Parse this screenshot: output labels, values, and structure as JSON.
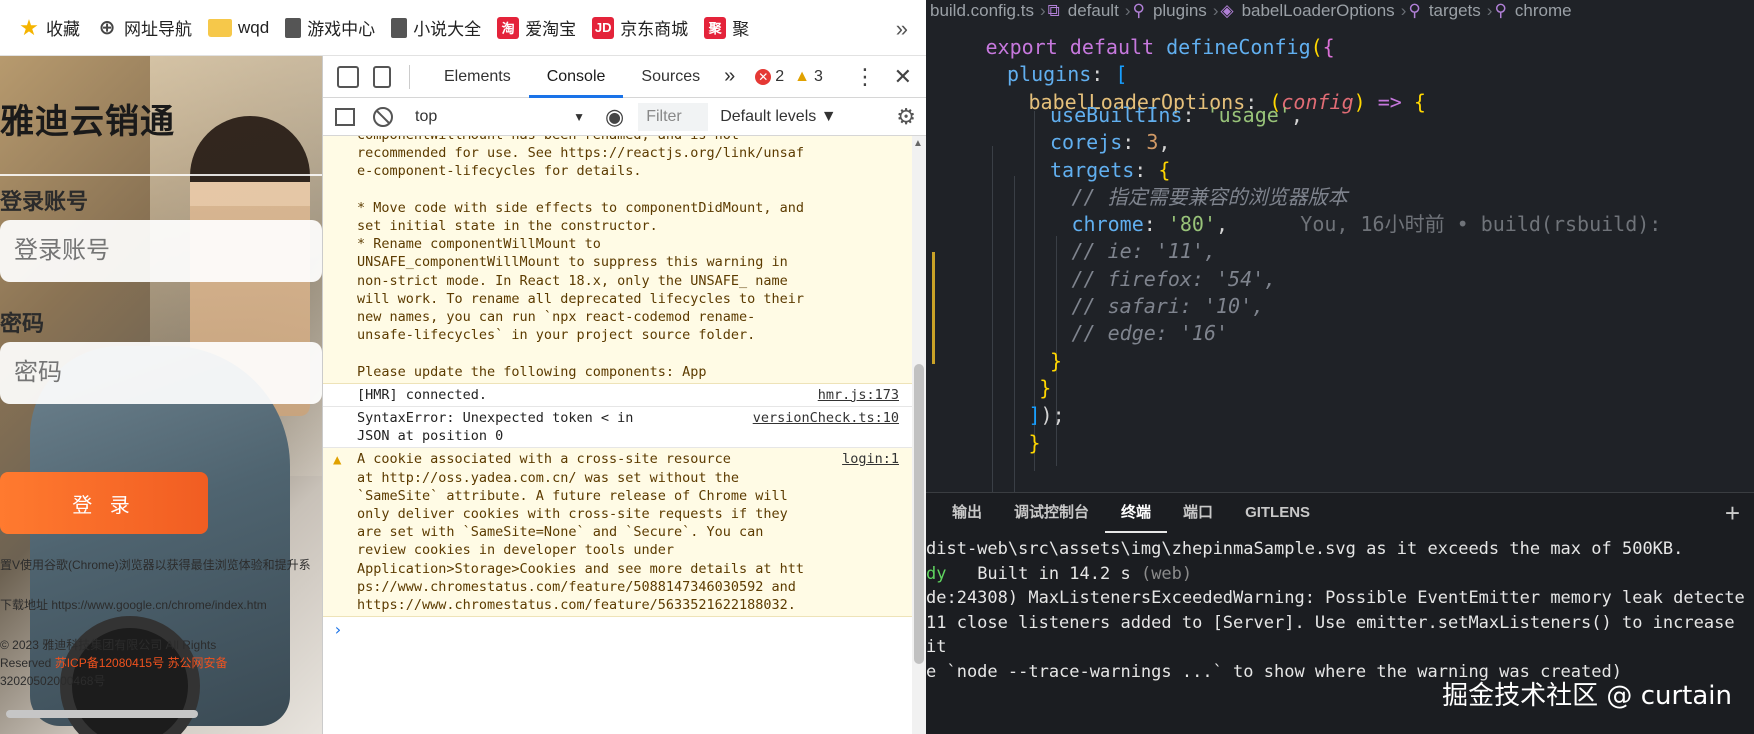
{
  "bookmarks": {
    "items": [
      {
        "label": "收藏",
        "icon": "star-icon"
      },
      {
        "label": "网址导航",
        "icon": "globe-icon"
      },
      {
        "label": "wqd",
        "icon": "folder-icon"
      },
      {
        "label": "游戏中心",
        "icon": "doc-icon"
      },
      {
        "label": "小说大全",
        "icon": "doc-icon"
      },
      {
        "label": "爱淘宝",
        "icon": "taobao-icon",
        "badge": "淘"
      },
      {
        "label": "京东商城",
        "icon": "jd-icon",
        "badge": "JD"
      },
      {
        "label": "聚",
        "icon": "ju-icon",
        "badge": "聚"
      }
    ],
    "more": "»"
  },
  "login": {
    "title": "雅迪云销通",
    "account_label": "登录账号",
    "account_placeholder": "登录账号",
    "password_label": "密码",
    "password_placeholder": "密码",
    "login_button": "登 录",
    "footer_line1": "置V使用谷歌(Chrome)浏览器以获得最佳浏览体验和提升系",
    "footer_line2": "下载地址 https://www.google.cn/chrome/index.htm",
    "footer_line3": "© 2023 雅迪科技集团有限公司 All Rights",
    "footer_line4_prefix": "Reserved",
    "footer_icp": "苏ICP备12080415号",
    "footer_police": "苏公网安备",
    "footer_line5": "32020502000468号"
  },
  "devtools": {
    "tabs": [
      "Elements",
      "Console",
      "Sources"
    ],
    "active_tab": "Console",
    "more_tabs": "»",
    "error_count": "2",
    "warning_count": "3",
    "context": "top",
    "filter_placeholder": "Filter",
    "levels": "Default levels ▼",
    "messages": [
      {
        "type": "warn",
        "text": "componentWillMount has been renamed, and is not\nrecommended for use. See https://reactjs.org/link/unsaf\ne-component-lifecycles for details.\n\n* Move code with side effects to componentDidMount, and\nset initial state in the constructor.\n* Rename componentWillMount to\nUNSAFE_componentWillMount to suppress this warning in\nnon-strict mode. In React 18.x, only the UNSAFE_ name\nwill work. To rename all deprecated lifecycles to their\nnew names, you can run `npx react-codemod rename-\nunsafe-lifecycles` in your project source folder.\n\nPlease update the following components: App",
        "source": ""
      },
      {
        "type": "info",
        "text": "[HMR] connected.",
        "source": "hmr.js:173"
      },
      {
        "type": "info",
        "text": "SyntaxError: Unexpected token < in\nJSON at position 0",
        "source": "versionCheck.ts:10"
      },
      {
        "type": "warn-icon",
        "text": "A cookie associated with a cross-site resource\nat http://oss.yadea.com.cn/ was set without the\n`SameSite` attribute. A future release of Chrome will\nonly deliver cookies with cross-site requests if they\nare set with `SameSite=None` and `Secure`. You can\nreview cookies in developer tools under\nApplication>Storage>Cookies and see more details at htt\nps://www.chromestatus.com/feature/5088147346030592 and\nhttps://www.chromestatus.com/feature/5633521622188032.",
        "source": "login:1"
      }
    ],
    "prompt": "›"
  },
  "vscode": {
    "breadcrumbs": [
      "build.config.ts",
      "default",
      "plugins",
      "babelLoaderOptions",
      "targets",
      "chrome"
    ],
    "code_lines": [
      {
        "indent": 1,
        "tokens": [
          [
            "kw",
            "export "
          ],
          [
            "kw",
            "default "
          ],
          [
            "fn",
            "defineConfig"
          ],
          [
            "br1",
            "("
          ],
          [
            "br2",
            "{"
          ]
        ]
      },
      {
        "indent": 2,
        "tokens": [
          [
            "key",
            "plugins"
          ],
          [
            "plain",
            ": "
          ],
          [
            "br3",
            "["
          ]
        ]
      },
      {
        "indent": 3,
        "tokens": [
          [
            "prop",
            "babelLoaderOptions"
          ],
          [
            "plain",
            ": "
          ],
          [
            "br1",
            "("
          ],
          [
            "param",
            "config"
          ],
          [
            "br1",
            ")"
          ],
          [
            "plain",
            " "
          ],
          [
            "kw",
            "=>"
          ],
          [
            "plain",
            " "
          ],
          [
            "br1",
            "{"
          ]
        ]
      },
      {
        "indent": 4,
        "tokens": [
          [
            "key",
            "useBuiltIns"
          ],
          [
            "plain",
            ": "
          ],
          [
            "str",
            "'usage'"
          ],
          [
            "plain",
            ","
          ]
        ]
      },
      {
        "indent": 4,
        "tokens": [
          [
            "key",
            "corejs"
          ],
          [
            "plain",
            ": "
          ],
          [
            "num",
            "3"
          ],
          [
            "plain",
            ","
          ]
        ]
      },
      {
        "indent": 4,
        "tokens": [
          [
            "key",
            "targets"
          ],
          [
            "plain",
            ": "
          ],
          [
            "br1",
            "{"
          ]
        ]
      },
      {
        "indent": 5,
        "tokens": [
          [
            "cm",
            "// 指定需要兼容的浏览器版本"
          ]
        ]
      },
      {
        "indent": 5,
        "tokens": [
          [
            "key",
            "chrome"
          ],
          [
            "plain",
            ": "
          ],
          [
            "str",
            "'80'"
          ],
          [
            "plain",
            ","
          ],
          [
            "ghost",
            "      You, 16小时前 • build(rsbuild):"
          ]
        ]
      },
      {
        "indent": 5,
        "tokens": [
          [
            "cm",
            "// ie: '11',"
          ]
        ]
      },
      {
        "indent": 5,
        "tokens": [
          [
            "cm",
            "// firefox: '54',"
          ]
        ]
      },
      {
        "indent": 5,
        "tokens": [
          [
            "cm",
            "// safari: '10',"
          ]
        ]
      },
      {
        "indent": 5,
        "tokens": [
          [
            "cm",
            "// edge: '16'"
          ]
        ]
      },
      {
        "indent": 4,
        "tokens": [
          [
            "br1",
            "}"
          ]
        ]
      },
      {
        "indent": 3.5,
        "tokens": [
          [
            "br1",
            "}"
          ]
        ]
      },
      {
        "indent": 3,
        "tokens": [
          [
            "br3",
            "]"
          ],
          [
            "plain",
            ");"
          ]
        ]
      },
      {
        "indent": 3,
        "tokens": [
          [
            "br1",
            "}"
          ]
        ]
      }
    ],
    "panel_tabs": [
      "输出",
      "调试控制台",
      "终端",
      "端口",
      "GITLENS"
    ],
    "active_panel_tab": "终端",
    "panel_add": "+",
    "terminal": [
      {
        "parts": [
          [
            "plain",
            "dist-web\\src\\assets\\img\\zhepinmaSample.svg as it exceeds the max of 500KB."
          ]
        ]
      },
      {
        "parts": [
          [
            "green",
            "dy"
          ],
          [
            "plain",
            "   Built in 14.2 s "
          ],
          [
            "dim",
            "(web)"
          ]
        ]
      },
      {
        "parts": [
          [
            "plain",
            "de:24308) MaxListenersExceededWarning: Possible EventEmitter memory leak detecte"
          ]
        ]
      },
      {
        "parts": [
          [
            "plain",
            "11 close listeners added to [Server]. Use emitter.setMaxListeners() to increase"
          ]
        ]
      },
      {
        "parts": [
          [
            "plain",
            "it"
          ]
        ]
      },
      {
        "parts": [
          [
            "plain",
            "e `node --trace-warnings ...` to show where the warning was created)"
          ]
        ]
      }
    ],
    "watermark": "掘金技术社区 @ curtain"
  }
}
